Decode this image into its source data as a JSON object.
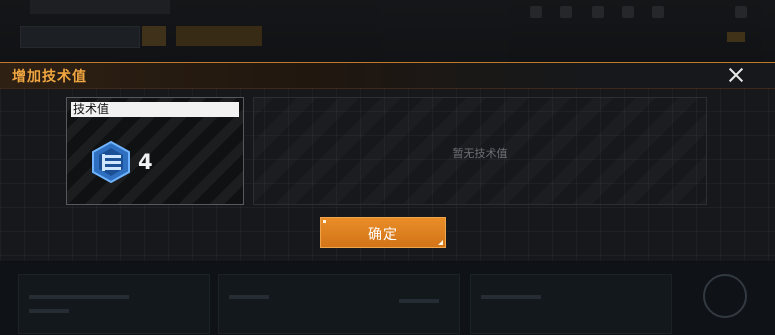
{
  "dialog": {
    "title": "增加技术值",
    "close_icon": "close-icon",
    "confirm_label": "确定"
  },
  "tech_item": {
    "label": "技术值",
    "icon": "tech-point-icon",
    "count": "4"
  },
  "empty_panel": {
    "text": "暂无技术值"
  },
  "colors": {
    "accent": "#f0a640",
    "button": "#e08020",
    "background": "#16181b"
  }
}
